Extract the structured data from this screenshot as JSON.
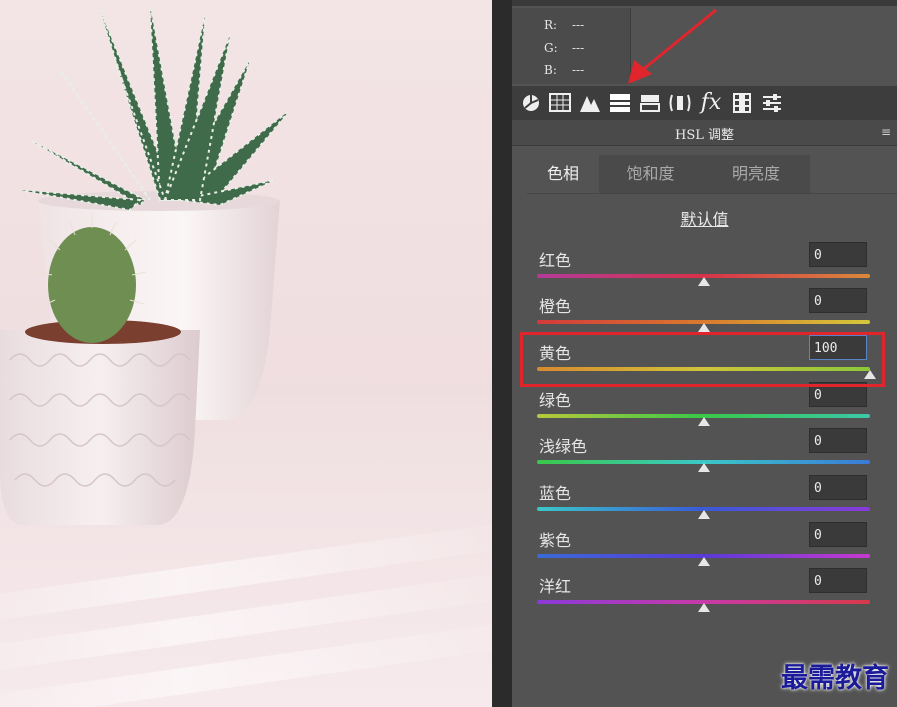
{
  "rgb_readout": [
    {
      "channel": "R:",
      "value": "---"
    },
    {
      "channel": "G:",
      "value": "---"
    },
    {
      "channel": "B:",
      "value": "---"
    }
  ],
  "toolbar": {
    "icons": [
      "basic-icon",
      "tone-curve-icon",
      "detail-icon",
      "hsl-icon",
      "split-toning-icon",
      "lens-corrections-icon",
      "effects-icon",
      "camera-calibration-icon",
      "presets-icon"
    ],
    "fx_glyph": "fx"
  },
  "panel": {
    "title": "HSL 调整",
    "menu_glyph": "≡"
  },
  "tabs": [
    {
      "label": "色相",
      "selected": true
    },
    {
      "label": "饱和度",
      "selected": false
    },
    {
      "label": "明亮度",
      "selected": false
    }
  ],
  "defaults_link": "默认值",
  "colors": [
    {
      "label": "红色",
      "value": "0"
    },
    {
      "label": "橙色",
      "value": "0"
    },
    {
      "label": "黄色",
      "value": "100"
    },
    {
      "label": "绿色",
      "value": "0"
    },
    {
      "label": "浅绿色",
      "value": "0"
    },
    {
      "label": "蓝色",
      "value": "0"
    },
    {
      "label": "紫色",
      "value": "0"
    },
    {
      "label": "洋红",
      "value": "0"
    }
  ],
  "slider_range": [
    -100,
    100
  ],
  "annotation_color": "#e0262c",
  "watermark": "最需教育"
}
